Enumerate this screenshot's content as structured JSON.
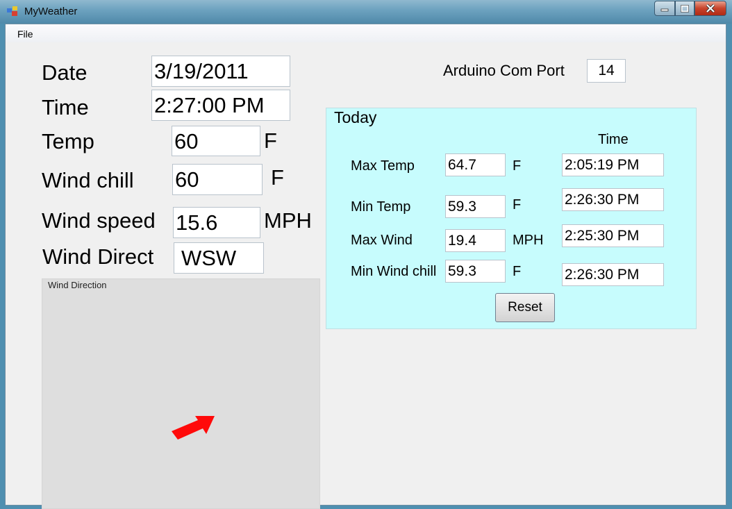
{
  "window": {
    "title": "MyWeather",
    "menu": [
      "File"
    ]
  },
  "fields": {
    "date": {
      "label": "Date",
      "value": "3/19/2011"
    },
    "time": {
      "label": "Time",
      "value": "2:27:00 PM"
    },
    "temp": {
      "label": "Temp",
      "value": "60",
      "unit": "F"
    },
    "wind_chill": {
      "label": "Wind chill",
      "value": "60",
      "unit": "F"
    },
    "wind_speed": {
      "label": "Wind speed",
      "value": "15.6",
      "unit": "MPH"
    },
    "wind_direct": {
      "label": "Wind Direct",
      "value": "WSW"
    }
  },
  "com_port": {
    "label": "Arduino Com Port",
    "value": "14"
  },
  "wind_direction_panel": {
    "label": "Wind Direction",
    "arrow_color": "#ff0000"
  },
  "today": {
    "label": "Today",
    "time_header": "Time",
    "rows": [
      {
        "label": "Max Temp",
        "value": "64.7",
        "unit": "F",
        "time": "2:05:19 PM"
      },
      {
        "label": "Min Temp",
        "value": "59.3",
        "unit": "F",
        "time": "2:26:30 PM"
      },
      {
        "label": "Max Wind",
        "value": "19.4",
        "unit": "MPH",
        "time": "2:25:30 PM"
      },
      {
        "label": "Min Wind chill",
        "value": "59.3",
        "unit": "F",
        "time": "2:26:30 PM"
      }
    ],
    "reset_label": "Reset",
    "background": "#c7fcfd"
  }
}
